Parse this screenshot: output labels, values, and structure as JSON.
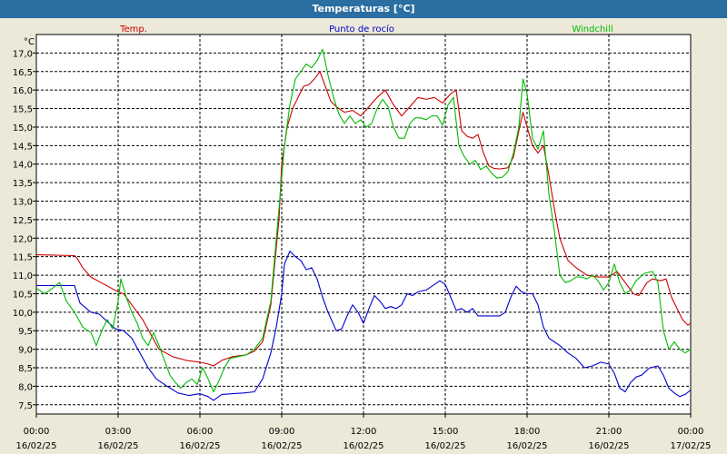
{
  "window": {
    "title": "Temperaturas [°C]"
  },
  "chart_data": {
    "type": "line",
    "title": "Temperaturas [°C]",
    "ylabel": "°C",
    "xlabel": "",
    "ylim": [
      7.25,
      17.5
    ],
    "xlim": [
      0,
      24
    ],
    "grid": true,
    "legend_position": "top",
    "yticks": [
      "7,5",
      "8,0",
      "8,5",
      "9,0",
      "9,5",
      "10,0",
      "10,5",
      "11,0",
      "11,5",
      "12,0",
      "12,5",
      "13,0",
      "13,5",
      "14,0",
      "14,5",
      "15,0",
      "15,5",
      "16,0",
      "16,5",
      "17,0"
    ],
    "ytick_values": [
      7.5,
      8.0,
      8.5,
      9.0,
      9.5,
      10.0,
      10.5,
      11.0,
      11.5,
      12.0,
      12.5,
      13.0,
      13.5,
      14.0,
      14.5,
      15.0,
      15.5,
      16.0,
      16.5,
      17.0
    ],
    "xticks": [
      {
        "hour": 0,
        "time": "00:00",
        "date": "16/02/25"
      },
      {
        "hour": 3,
        "time": "03:00",
        "date": "16/02/25"
      },
      {
        "hour": 6,
        "time": "06:00",
        "date": "16/02/25"
      },
      {
        "hour": 9,
        "time": "09:00",
        "date": "16/02/25"
      },
      {
        "hour": 12,
        "time": "12:00",
        "date": "16/02/25"
      },
      {
        "hour": 15,
        "time": "15:00",
        "date": "16/02/25"
      },
      {
        "hour": 18,
        "time": "18:00",
        "date": "16/02/25"
      },
      {
        "hour": 21,
        "time": "21:00",
        "date": "16/02/25"
      },
      {
        "hour": 24,
        "time": "00:00",
        "date": "17/02/25"
      }
    ],
    "series": [
      {
        "name": "Temp.",
        "color": "#cc0000",
        "points": [
          [
            0,
            11.55
          ],
          [
            1.4,
            11.53
          ],
          [
            1.5,
            11.45
          ],
          [
            1.7,
            11.2
          ],
          [
            2,
            10.95
          ],
          [
            2.5,
            10.75
          ],
          [
            3,
            10.55
          ],
          [
            3.2,
            10.5
          ],
          [
            3.4,
            10.3
          ],
          [
            3.6,
            10.1
          ],
          [
            3.9,
            9.8
          ],
          [
            4.2,
            9.4
          ],
          [
            4.5,
            9.0
          ],
          [
            5,
            8.8
          ],
          [
            5.5,
            8.7
          ],
          [
            6,
            8.65
          ],
          [
            6.3,
            8.6
          ],
          [
            6.5,
            8.55
          ],
          [
            6.8,
            8.7
          ],
          [
            7.2,
            8.8
          ],
          [
            7.7,
            8.85
          ],
          [
            8,
            8.95
          ],
          [
            8.3,
            9.2
          ],
          [
            8.6,
            10.2
          ],
          [
            8.9,
            12.5
          ],
          [
            9,
            14.0
          ],
          [
            9.2,
            15.0
          ],
          [
            9.4,
            15.5
          ],
          [
            9.6,
            15.8
          ],
          [
            9.8,
            16.1
          ],
          [
            10,
            16.15
          ],
          [
            10.2,
            16.3
          ],
          [
            10.4,
            16.5
          ],
          [
            10.6,
            16.1
          ],
          [
            10.8,
            15.7
          ],
          [
            11,
            15.55
          ],
          [
            11.3,
            15.4
          ],
          [
            11.6,
            15.45
          ],
          [
            11.9,
            15.3
          ],
          [
            12.2,
            15.55
          ],
          [
            12.5,
            15.8
          ],
          [
            12.8,
            16.0
          ],
          [
            13.1,
            15.6
          ],
          [
            13.4,
            15.3
          ],
          [
            13.7,
            15.55
          ],
          [
            14,
            15.8
          ],
          [
            14.3,
            15.75
          ],
          [
            14.6,
            15.8
          ],
          [
            14.9,
            15.65
          ],
          [
            15.2,
            15.9
          ],
          [
            15.4,
            16.0
          ],
          [
            15.6,
            14.9
          ],
          [
            15.8,
            14.75
          ],
          [
            16,
            14.7
          ],
          [
            16.2,
            14.8
          ],
          [
            16.4,
            14.3
          ],
          [
            16.6,
            13.95
          ],
          [
            16.8,
            13.88
          ],
          [
            17,
            13.87
          ],
          [
            17.3,
            13.9
          ],
          [
            17.5,
            14.2
          ],
          [
            17.7,
            14.9
          ],
          [
            17.85,
            15.4
          ],
          [
            18,
            15.0
          ],
          [
            18.2,
            14.5
          ],
          [
            18.4,
            14.3
          ],
          [
            18.6,
            14.5
          ],
          [
            18.8,
            13.7
          ],
          [
            19,
            12.8
          ],
          [
            19.2,
            12.0
          ],
          [
            19.5,
            11.4
          ],
          [
            19.8,
            11.2
          ],
          [
            20.2,
            11.0
          ],
          [
            20.6,
            10.95
          ],
          [
            21,
            10.95
          ],
          [
            21.3,
            11.1
          ],
          [
            21.6,
            10.8
          ],
          [
            21.9,
            10.5
          ],
          [
            22.1,
            10.45
          ],
          [
            22.4,
            10.8
          ],
          [
            22.6,
            10.9
          ],
          [
            22.9,
            10.85
          ],
          [
            23.1,
            10.9
          ],
          [
            23.3,
            10.4
          ],
          [
            23.5,
            10.1
          ],
          [
            23.7,
            9.8
          ],
          [
            23.9,
            9.65
          ],
          [
            24,
            9.7
          ]
        ]
      },
      {
        "name": "Punto de rocío",
        "color": "#0000cc",
        "points": [
          [
            0,
            10.72
          ],
          [
            0.8,
            10.72
          ],
          [
            1.4,
            10.72
          ],
          [
            1.6,
            10.25
          ],
          [
            2,
            10.0
          ],
          [
            2.3,
            9.95
          ],
          [
            2.6,
            9.75
          ],
          [
            2.9,
            9.55
          ],
          [
            3.2,
            9.5
          ],
          [
            3.5,
            9.3
          ],
          [
            3.8,
            8.9
          ],
          [
            4.1,
            8.5
          ],
          [
            4.4,
            8.2
          ],
          [
            4.8,
            8.0
          ],
          [
            5.2,
            7.82
          ],
          [
            5.6,
            7.75
          ],
          [
            6,
            7.8
          ],
          [
            6.3,
            7.72
          ],
          [
            6.5,
            7.62
          ],
          [
            6.8,
            7.78
          ],
          [
            7.2,
            7.8
          ],
          [
            7.6,
            7.82
          ],
          [
            8,
            7.85
          ],
          [
            8.3,
            8.2
          ],
          [
            8.6,
            8.9
          ],
          [
            8.8,
            9.6
          ],
          [
            9,
            10.5
          ],
          [
            9.1,
            11.3
          ],
          [
            9.3,
            11.65
          ],
          [
            9.5,
            11.5
          ],
          [
            9.7,
            11.4
          ],
          [
            9.9,
            11.15
          ],
          [
            10.1,
            11.2
          ],
          [
            10.3,
            10.9
          ],
          [
            10.5,
            10.4
          ],
          [
            10.7,
            10.0
          ],
          [
            11,
            9.5
          ],
          [
            11.2,
            9.55
          ],
          [
            11.4,
            9.9
          ],
          [
            11.6,
            10.2
          ],
          [
            11.8,
            10.0
          ],
          [
            12,
            9.7
          ],
          [
            12.2,
            10.1
          ],
          [
            12.4,
            10.45
          ],
          [
            12.6,
            10.3
          ],
          [
            12.8,
            10.1
          ],
          [
            13,
            10.15
          ],
          [
            13.2,
            10.1
          ],
          [
            13.4,
            10.2
          ],
          [
            13.6,
            10.5
          ],
          [
            13.8,
            10.45
          ],
          [
            14,
            10.55
          ],
          [
            14.3,
            10.6
          ],
          [
            14.6,
            10.75
          ],
          [
            14.8,
            10.85
          ],
          [
            15,
            10.75
          ],
          [
            15.2,
            10.4
          ],
          [
            15.4,
            10.05
          ],
          [
            15.6,
            10.1
          ],
          [
            15.8,
            10.0
          ],
          [
            16,
            10.1
          ],
          [
            16.2,
            9.9
          ],
          [
            16.5,
            9.9
          ],
          [
            16.8,
            9.9
          ],
          [
            17,
            9.9
          ],
          [
            17.2,
            10.0
          ],
          [
            17.4,
            10.4
          ],
          [
            17.6,
            10.7
          ],
          [
            17.8,
            10.55
          ],
          [
            18,
            10.5
          ],
          [
            18.2,
            10.5
          ],
          [
            18.4,
            10.2
          ],
          [
            18.6,
            9.6
          ],
          [
            18.8,
            9.3
          ],
          [
            19,
            9.2
          ],
          [
            19.2,
            9.1
          ],
          [
            19.5,
            8.9
          ],
          [
            19.8,
            8.75
          ],
          [
            20.1,
            8.5
          ],
          [
            20.4,
            8.55
          ],
          [
            20.7,
            8.65
          ],
          [
            21,
            8.6
          ],
          [
            21.2,
            8.35
          ],
          [
            21.4,
            7.95
          ],
          [
            21.6,
            7.85
          ],
          [
            21.8,
            8.1
          ],
          [
            22,
            8.25
          ],
          [
            22.2,
            8.3
          ],
          [
            22.5,
            8.5
          ],
          [
            22.8,
            8.55
          ],
          [
            23,
            8.3
          ],
          [
            23.2,
            7.95
          ],
          [
            23.4,
            7.82
          ],
          [
            23.6,
            7.72
          ],
          [
            23.8,
            7.78
          ],
          [
            24,
            7.9
          ]
        ]
      },
      {
        "name": "Windchill",
        "color": "#00bb00",
        "points": [
          [
            0,
            10.65
          ],
          [
            0.3,
            10.5
          ],
          [
            0.6,
            10.65
          ],
          [
            0.85,
            10.8
          ],
          [
            1.1,
            10.3
          ],
          [
            1.4,
            10.0
          ],
          [
            1.7,
            9.6
          ],
          [
            2,
            9.45
          ],
          [
            2.2,
            9.1
          ],
          [
            2.4,
            9.5
          ],
          [
            2.6,
            9.8
          ],
          [
            2.8,
            9.55
          ],
          [
            3,
            10.3
          ],
          [
            3.1,
            10.9
          ],
          [
            3.3,
            10.4
          ],
          [
            3.5,
            10.0
          ],
          [
            3.7,
            9.7
          ],
          [
            3.9,
            9.3
          ],
          [
            4.1,
            9.1
          ],
          [
            4.3,
            9.45
          ],
          [
            4.5,
            9.1
          ],
          [
            4.7,
            8.7
          ],
          [
            4.9,
            8.3
          ],
          [
            5.1,
            8.1
          ],
          [
            5.3,
            7.95
          ],
          [
            5.5,
            8.1
          ],
          [
            5.7,
            8.2
          ],
          [
            5.9,
            8.05
          ],
          [
            6.1,
            8.5
          ],
          [
            6.3,
            8.2
          ],
          [
            6.5,
            7.85
          ],
          [
            6.7,
            8.15
          ],
          [
            6.9,
            8.5
          ],
          [
            7.1,
            8.75
          ],
          [
            7.4,
            8.8
          ],
          [
            7.7,
            8.85
          ],
          [
            8,
            9.0
          ],
          [
            8.3,
            9.3
          ],
          [
            8.6,
            10.3
          ],
          [
            8.9,
            12.8
          ],
          [
            9.1,
            14.5
          ],
          [
            9.3,
            15.6
          ],
          [
            9.5,
            16.3
          ],
          [
            9.7,
            16.5
          ],
          [
            9.9,
            16.7
          ],
          [
            10.1,
            16.6
          ],
          [
            10.3,
            16.8
          ],
          [
            10.5,
            17.1
          ],
          [
            10.7,
            16.4
          ],
          [
            10.9,
            15.8
          ],
          [
            11.1,
            15.35
          ],
          [
            11.3,
            15.1
          ],
          [
            11.5,
            15.3
          ],
          [
            11.7,
            15.1
          ],
          [
            11.9,
            15.2
          ],
          [
            12.1,
            15.0
          ],
          [
            12.3,
            15.1
          ],
          [
            12.5,
            15.5
          ],
          [
            12.7,
            15.75
          ],
          [
            12.9,
            15.55
          ],
          [
            13.1,
            15.0
          ],
          [
            13.3,
            14.7
          ],
          [
            13.5,
            14.7
          ],
          [
            13.7,
            15.1
          ],
          [
            13.9,
            15.25
          ],
          [
            14.1,
            15.25
          ],
          [
            14.3,
            15.2
          ],
          [
            14.5,
            15.3
          ],
          [
            14.7,
            15.3
          ],
          [
            14.9,
            15.05
          ],
          [
            15.1,
            15.6
          ],
          [
            15.3,
            15.8
          ],
          [
            15.5,
            14.5
          ],
          [
            15.7,
            14.2
          ],
          [
            15.9,
            14.0
          ],
          [
            16.1,
            14.1
          ],
          [
            16.3,
            13.85
          ],
          [
            16.5,
            13.95
          ],
          [
            16.7,
            13.75
          ],
          [
            16.9,
            13.62
          ],
          [
            17.1,
            13.65
          ],
          [
            17.3,
            13.8
          ],
          [
            17.5,
            14.3
          ],
          [
            17.7,
            15.0
          ],
          [
            17.85,
            16.3
          ],
          [
            18,
            15.9
          ],
          [
            18.2,
            14.7
          ],
          [
            18.4,
            14.4
          ],
          [
            18.6,
            14.9
          ],
          [
            18.8,
            13.2
          ],
          [
            19,
            12.2
          ],
          [
            19.2,
            11.0
          ],
          [
            19.4,
            10.8
          ],
          [
            19.6,
            10.85
          ],
          [
            19.8,
            10.95
          ],
          [
            20,
            10.95
          ],
          [
            20.2,
            10.9
          ],
          [
            20.4,
            11.0
          ],
          [
            20.6,
            10.85
          ],
          [
            20.8,
            10.6
          ],
          [
            21,
            10.8
          ],
          [
            21.2,
            11.3
          ],
          [
            21.4,
            10.8
          ],
          [
            21.6,
            10.5
          ],
          [
            21.8,
            10.6
          ],
          [
            22,
            10.85
          ],
          [
            22.3,
            11.05
          ],
          [
            22.6,
            11.1
          ],
          [
            22.8,
            10.8
          ],
          [
            23,
            9.5
          ],
          [
            23.2,
            9.0
          ],
          [
            23.4,
            9.2
          ],
          [
            23.6,
            9.0
          ],
          [
            23.8,
            8.9
          ],
          [
            24,
            9.0
          ]
        ]
      }
    ]
  }
}
